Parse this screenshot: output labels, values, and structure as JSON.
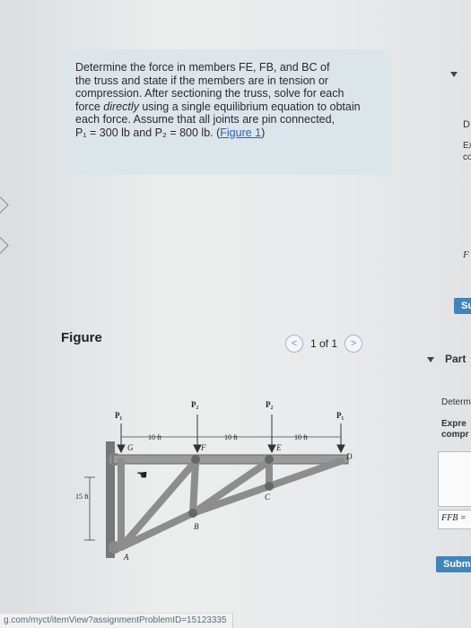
{
  "problem": {
    "line1": "Determine the force in members FE, FB, and BC of",
    "line2": "the truss and state if the members are in tension or",
    "line3": "compression. After sectioning the truss, solve for each",
    "line4_pre": "force ",
    "line4_em": "directly",
    "line4_post": " using a single equilibrium equation to obtain",
    "line5": "each force. Assume that all joints are pin connected,",
    "line6": "P₁ = 300 lb and P₂ = 800 lb. (",
    "figure_link": "Figure 1",
    "line6_end": ")"
  },
  "figure": {
    "title": "Figure",
    "pager": "1 of 1",
    "prev": "<",
    "next": ">",
    "labels": {
      "P1a": "P₁",
      "P2a": "P₂",
      "P2b": "P₂",
      "P1b": "P₁",
      "d1": "10 ft",
      "d2": "10 ft",
      "d3": "10 ft",
      "h": "15 ft",
      "G": "G",
      "F": "F",
      "E": "E",
      "D": "D",
      "C": "C",
      "B": "B",
      "A": "A"
    }
  },
  "url": "g.com/myct/itemView?assignmentProblemID=15123335",
  "right_pane": {
    "D": "D",
    "Ex": "Ex",
    "co": "co",
    "F": "F",
    "Su": "Su",
    "part": "Part",
    "determine": "Determ",
    "express": "Expre",
    "compr": "compr",
    "ffb": "FFB =",
    "submit": "Submit"
  }
}
